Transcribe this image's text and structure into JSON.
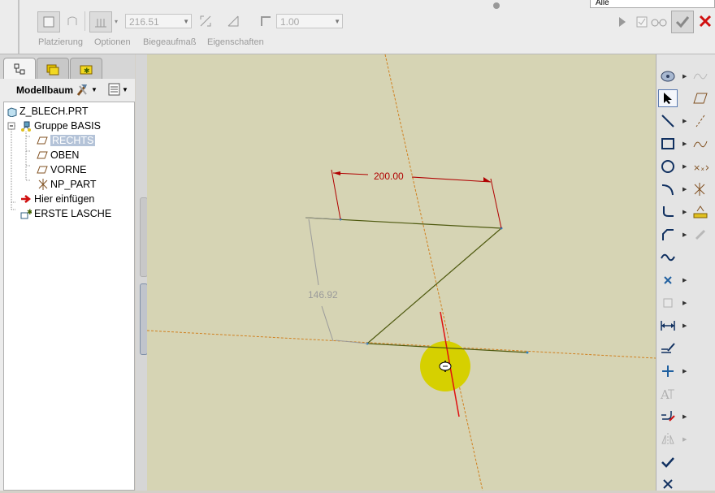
{
  "dashboard": {
    "thickness_value": "216.51",
    "bend_radius_value": "1.00",
    "filter_value": "Alle",
    "tabs": [
      "Platzierung",
      "Optionen",
      "Biegeaufmaß",
      "Eigenschaften"
    ]
  },
  "model_tree": {
    "header_label": "Modellbaum",
    "items": [
      {
        "label": "Z_BLECH.PRT",
        "icon": "part-icon"
      },
      {
        "label": "Gruppe BASIS",
        "icon": "group-icon"
      },
      {
        "label": "RECHTS",
        "icon": "datum-plane-icon"
      },
      {
        "label": "OBEN",
        "icon": "datum-plane-icon"
      },
      {
        "label": "VORNE",
        "icon": "datum-plane-icon"
      },
      {
        "label": "NP_PART",
        "icon": "coordinate-system-icon"
      },
      {
        "label": "Hier einfügen",
        "icon": "insert-here-arrow-icon"
      },
      {
        "label": "ERSTE LASCHE",
        "icon": "flat-wall-icon"
      }
    ]
  },
  "sketch": {
    "dim_horizontal": "200.00",
    "dim_vertical": "146.92"
  },
  "colors": {
    "canvas_bg": "#d6d4b4",
    "dimension_red": "#b00000",
    "sketch_line": "#4f5a10",
    "reference_orange": "#d08020",
    "cursor_highlight": "#d6d000",
    "cancel_red": "#d01010"
  }
}
